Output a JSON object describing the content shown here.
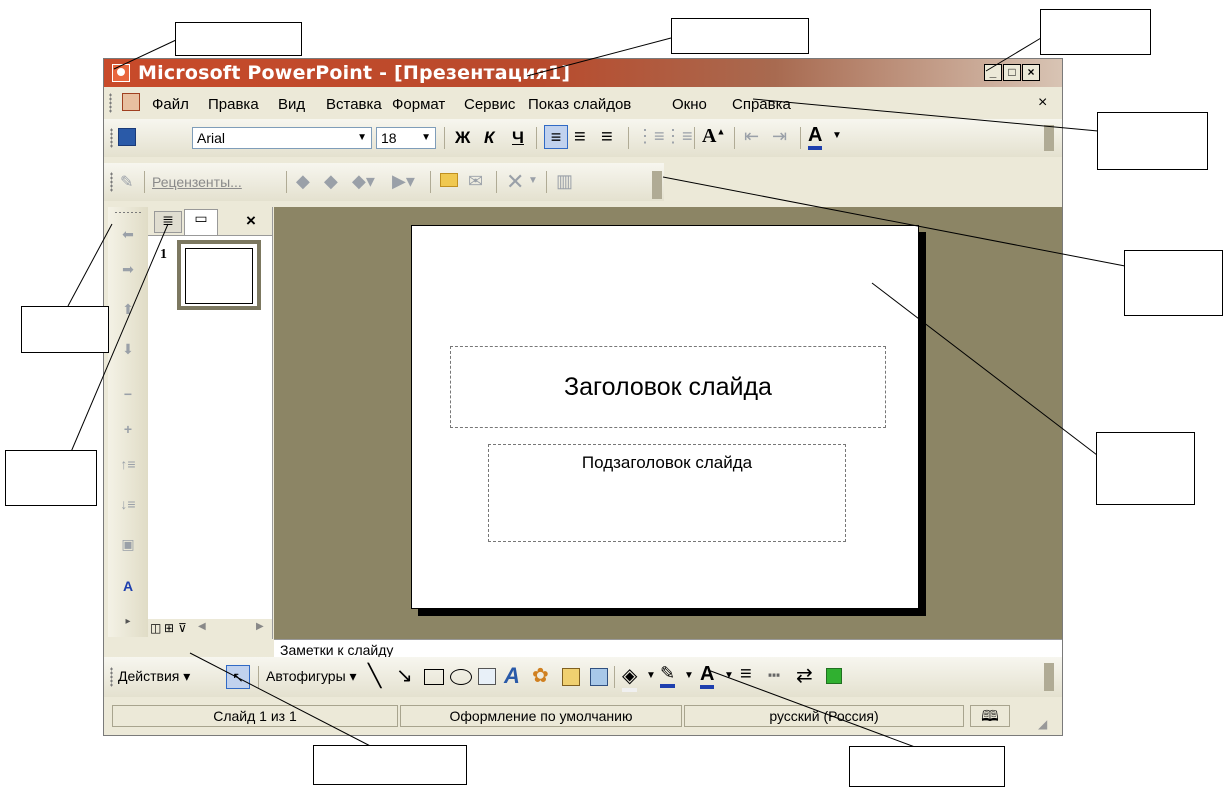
{
  "window": {
    "title": "Microsoft PowerPoint - [Презентация1]",
    "controls": {
      "minimize": "_",
      "maximize": "□",
      "close": "×"
    }
  },
  "menu": {
    "items": [
      "Файл",
      "Правка",
      "Вид",
      "Вставка",
      "Формат",
      "Сервис",
      "Показ слайдов",
      "Окно",
      "Справка"
    ],
    "close_glyph": "×"
  },
  "formatting_toolbar": {
    "font": "Arial",
    "size": "18",
    "bold": "Ж",
    "italic": "К",
    "underline": "Ч"
  },
  "review_toolbar": {
    "reviewers": "Рецензенты..."
  },
  "outline_pane": {
    "close_glyph": "×",
    "slide_number": "1"
  },
  "slide": {
    "title": "Заголовок слайда",
    "subtitle": "Подзаголовок слайда"
  },
  "notes": {
    "text": "Заметки к слайду"
  },
  "drawing_toolbar": {
    "actions": "Действия ▾",
    "autoshapes": "Автофигуры ▾"
  },
  "status_bar": {
    "slide": "Слайд 1 из 1",
    "design": "Оформление по умолчанию",
    "language": "русский (Россия)"
  },
  "icons": [
    "app-icon",
    "save-icon",
    "bold-icon",
    "align-left-icon",
    "align-center-icon",
    "align-right-icon",
    "numbering-icon",
    "bullets-icon",
    "increase-font-icon",
    "decrease-indent-icon",
    "increase-indent-icon",
    "font-color-icon",
    "arrow-icon",
    "line-icon",
    "rectangle-icon",
    "oval-icon",
    "textbox-icon",
    "wordart-icon",
    "diagram-icon",
    "clipart-icon",
    "picture-icon",
    "fill-color-icon",
    "line-color-icon",
    "line-style-icon",
    "dash-style-icon",
    "arrow-style-icon",
    "shadow-icon"
  ]
}
